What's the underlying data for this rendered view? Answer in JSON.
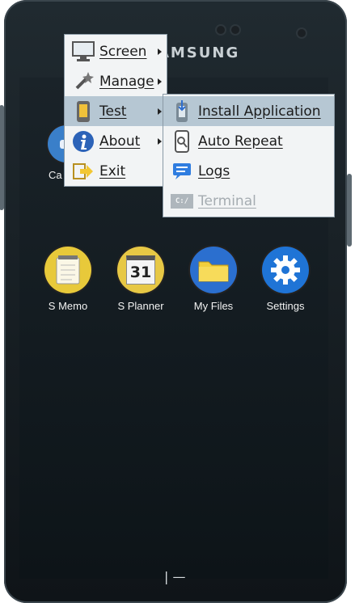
{
  "device": {
    "brand": "SAMSUNG"
  },
  "apps": [
    {
      "label": "S Memo",
      "icon": "notepad-icon"
    },
    {
      "label": "S Planner",
      "icon": "calendar-icon",
      "date": "31"
    },
    {
      "label": "My Files",
      "icon": "folder-icon"
    },
    {
      "label": "Settings",
      "icon": "gear-icon"
    }
  ],
  "partial_app": {
    "label": "Ca"
  },
  "context_menu": {
    "items": [
      {
        "label": "Screen",
        "icon": "monitor-icon",
        "has_submenu": true
      },
      {
        "label": "Manage",
        "icon": "wand-icon",
        "has_submenu": true
      },
      {
        "label": "Test",
        "icon": "phone-icon",
        "has_submenu": true,
        "active": true
      },
      {
        "label": "About",
        "icon": "info-icon",
        "has_submenu": true
      },
      {
        "label": "Exit",
        "icon": "exit-icon",
        "has_submenu": false
      }
    ]
  },
  "submenu": {
    "items": [
      {
        "label": "Install Application",
        "icon": "install-icon",
        "highlighted": true
      },
      {
        "label": "Auto Repeat",
        "icon": "auto-repeat-icon"
      },
      {
        "label": "Logs",
        "icon": "logs-icon"
      },
      {
        "label": "Terminal",
        "icon": "terminal-icon",
        "disabled": true
      }
    ]
  },
  "terminal_prompt": "C:/",
  "home_indicator": "| —",
  "colors": {
    "menu_highlight": "#b6c7d3",
    "menu_bg": "#f2f4f5",
    "screen_bg": "#121a1f"
  }
}
